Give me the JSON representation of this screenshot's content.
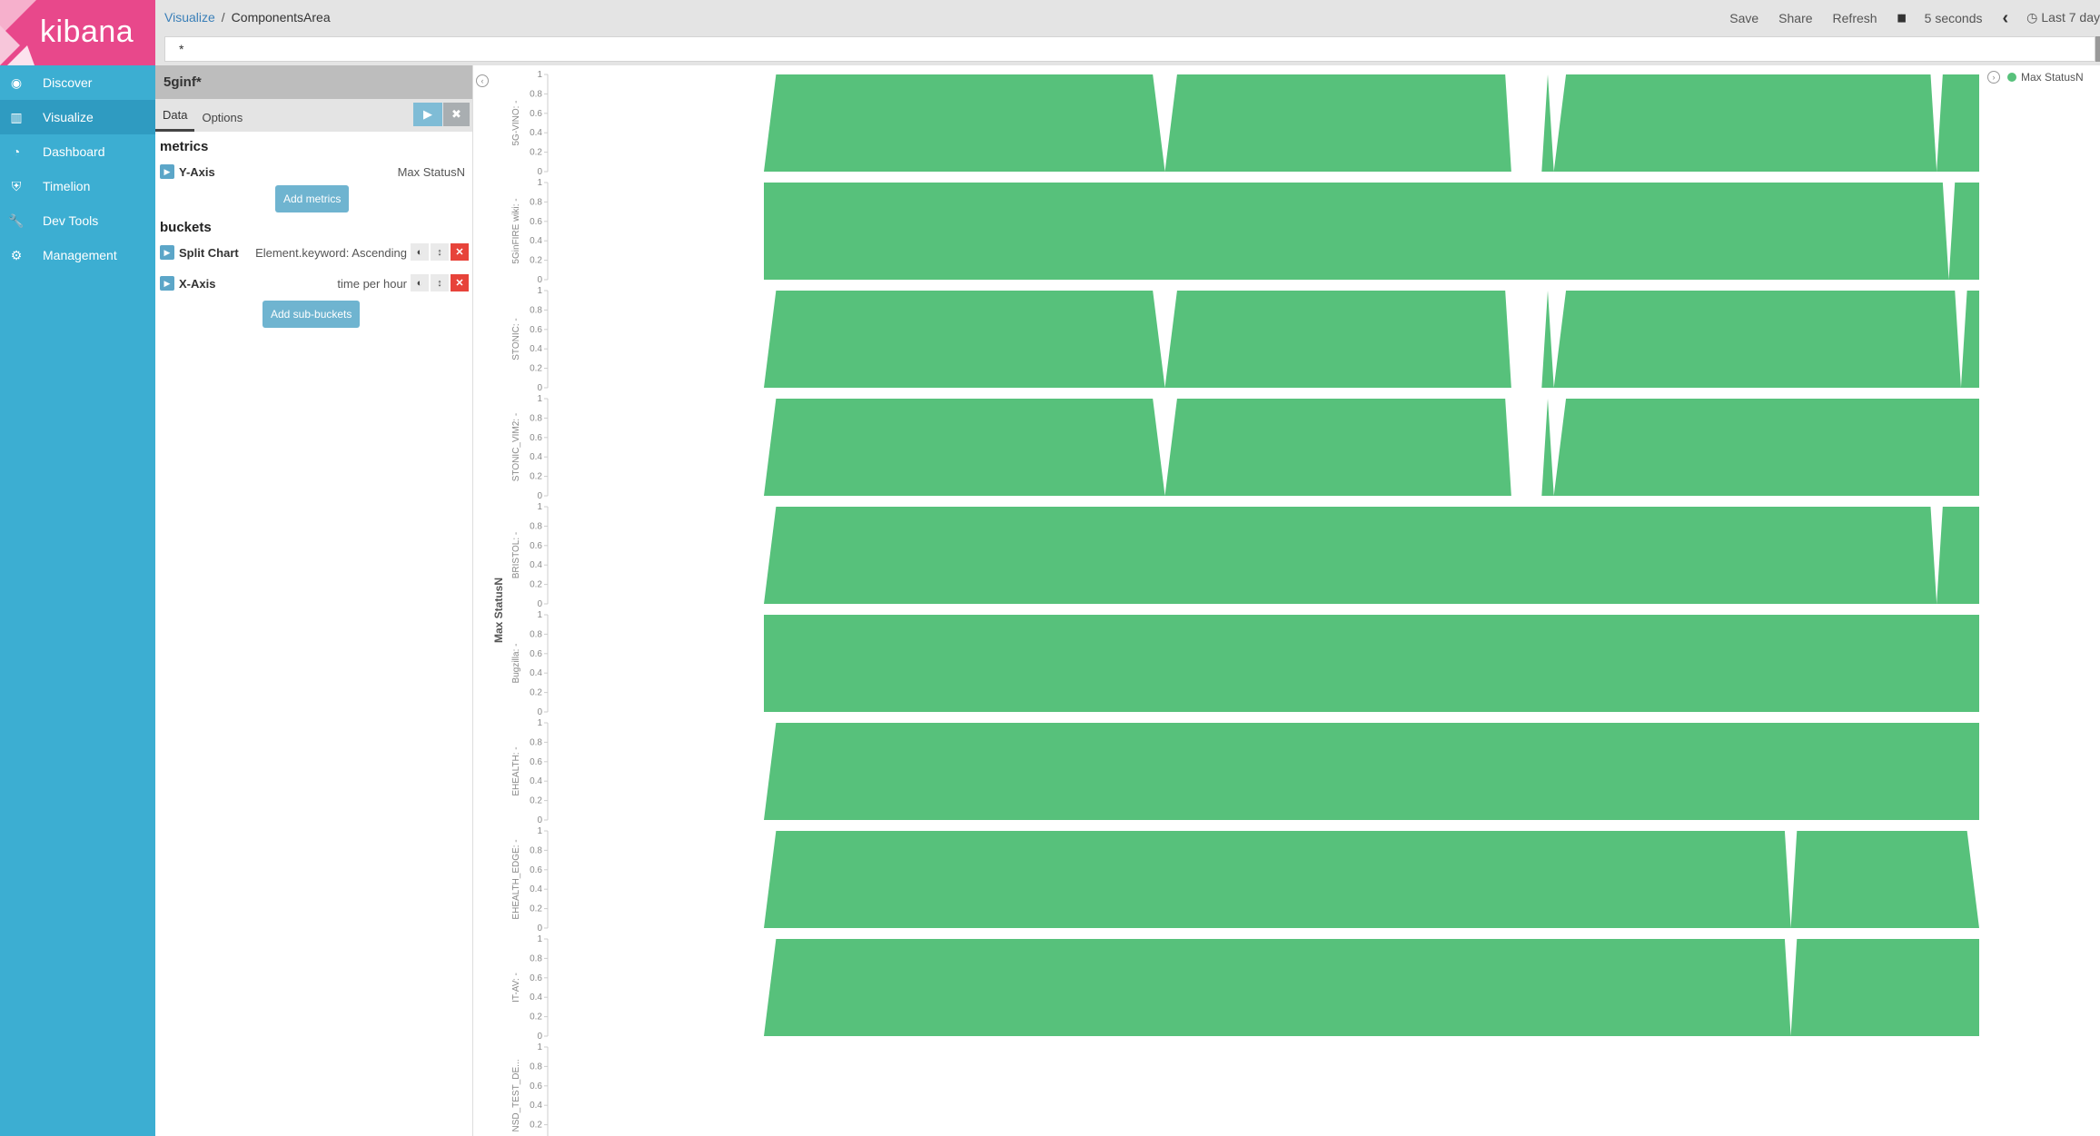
{
  "app": {
    "logo_text": "kibana"
  },
  "sidebar": {
    "items": [
      {
        "label": "Discover",
        "icon": "compass-icon",
        "glyph": "◉"
      },
      {
        "label": "Visualize",
        "icon": "bar-chart-icon",
        "glyph": "▥"
      },
      {
        "label": "Dashboard",
        "icon": "dashboard-icon",
        "glyph": "◔"
      },
      {
        "label": "Timelion",
        "icon": "shield-icon",
        "glyph": "⛨"
      },
      {
        "label": "Dev Tools",
        "icon": "wrench-icon",
        "glyph": "🔧"
      },
      {
        "label": "Management",
        "icon": "gear-icon",
        "glyph": "⚙"
      }
    ],
    "active": "Visualize"
  },
  "breadcrumb": {
    "root": "Visualize",
    "separator": "/",
    "current": "ComponentsArea"
  },
  "toolbar": {
    "save": "Save",
    "share": "Share",
    "refresh": "Refresh",
    "pause_icon": "▮▮",
    "interval": "5 seconds",
    "prev_icon": "‹",
    "time_range": "Last 7 day",
    "clock_icon": "◷"
  },
  "query": {
    "value": "*"
  },
  "editor": {
    "title": "5ginf*",
    "tabs": [
      "Data",
      "Options"
    ],
    "apply_icon": "▶",
    "discard_icon": "✖",
    "metrics_heading": "metrics",
    "metrics": [
      {
        "name": "Y-Axis",
        "value": "Max StatusN"
      }
    ],
    "add_metrics": "Add metrics",
    "buckets_heading": "buckets",
    "buckets": [
      {
        "name": "Split Chart",
        "value": "Element.keyword: Ascending"
      },
      {
        "name": "X-Axis",
        "value": "time per hour"
      }
    ],
    "add_buckets": "Add sub-buckets"
  },
  "colors": {
    "series": "#57c17b",
    "sidebar": "#3caed2",
    "logo": "#e8488b"
  },
  "legend": {
    "label": "Max StatusN",
    "toggle_icon": "›"
  },
  "chart_data": {
    "type": "area",
    "ylabel": "Max StatusN",
    "yticks": [
      "0",
      "0.2",
      "0.4",
      "0.6",
      "0.8",
      "1"
    ],
    "ylim": [
      0,
      1
    ],
    "x_domain": [
      0,
      100
    ],
    "series_name": "Max StatusN",
    "panels": [
      {
        "label": "5G-VINO: -",
        "points": [
          [
            0,
            0
          ],
          [
            1,
            1
          ],
          [
            32,
            1
          ],
          [
            33,
            0
          ],
          [
            34,
            1
          ],
          [
            61,
            1
          ],
          [
            61.5,
            0
          ],
          [
            64,
            0
          ],
          [
            64.5,
            1
          ],
          [
            65,
            0
          ],
          [
            66,
            1
          ],
          [
            96,
            1
          ],
          [
            96.5,
            0
          ],
          [
            97,
            1
          ],
          [
            100,
            1
          ]
        ]
      },
      {
        "label": "5GinFIRE wiki: -",
        "points": [
          [
            0,
            0
          ],
          [
            0,
            1
          ],
          [
            97,
            1
          ],
          [
            97.5,
            0
          ],
          [
            98,
            1
          ],
          [
            100,
            1
          ]
        ]
      },
      {
        "label": "STONIC: -",
        "points": [
          [
            0,
            0
          ],
          [
            1,
            1
          ],
          [
            32,
            1
          ],
          [
            33,
            0
          ],
          [
            34,
            1
          ],
          [
            61,
            1
          ],
          [
            61.5,
            0
          ],
          [
            64,
            0
          ],
          [
            64.5,
            1
          ],
          [
            65,
            0
          ],
          [
            66,
            1
          ],
          [
            98,
            1
          ],
          [
            98.5,
            0
          ],
          [
            99,
            1
          ],
          [
            100,
            1
          ]
        ]
      },
      {
        "label": "STONIC_VIM2: -",
        "points": [
          [
            0,
            0
          ],
          [
            1,
            1
          ],
          [
            32,
            1
          ],
          [
            33,
            0
          ],
          [
            34,
            1
          ],
          [
            61,
            1
          ],
          [
            61.5,
            0
          ],
          [
            64,
            0
          ],
          [
            64.5,
            1
          ],
          [
            65,
            0
          ],
          [
            66,
            1
          ],
          [
            100,
            1
          ]
        ]
      },
      {
        "label": "BRISTOL: -",
        "points": [
          [
            0,
            0
          ],
          [
            1,
            1
          ],
          [
            96,
            1
          ],
          [
            96.5,
            0
          ],
          [
            97,
            1
          ],
          [
            100,
            1
          ]
        ]
      },
      {
        "label": "Bugzilla: -",
        "points": [
          [
            0,
            0
          ],
          [
            0,
            1
          ],
          [
            100,
            1
          ]
        ]
      },
      {
        "label": "EHEALTH: -",
        "points": [
          [
            0,
            0
          ],
          [
            1,
            1
          ],
          [
            100,
            1
          ]
        ]
      },
      {
        "label": "EHEALTH_EDGE: -",
        "points": [
          [
            0,
            0
          ],
          [
            1,
            1
          ],
          [
            84,
            1
          ],
          [
            84.5,
            0
          ],
          [
            85,
            1
          ],
          [
            99,
            1
          ],
          [
            100,
            0
          ]
        ]
      },
      {
        "label": "IT-AV: -",
        "points": [
          [
            0,
            0
          ],
          [
            1,
            1
          ],
          [
            84,
            1
          ],
          [
            84.5,
            0
          ],
          [
            85,
            1
          ],
          [
            100,
            1
          ]
        ]
      },
      {
        "label": "NSD_TEST_DE...",
        "points": []
      }
    ]
  }
}
